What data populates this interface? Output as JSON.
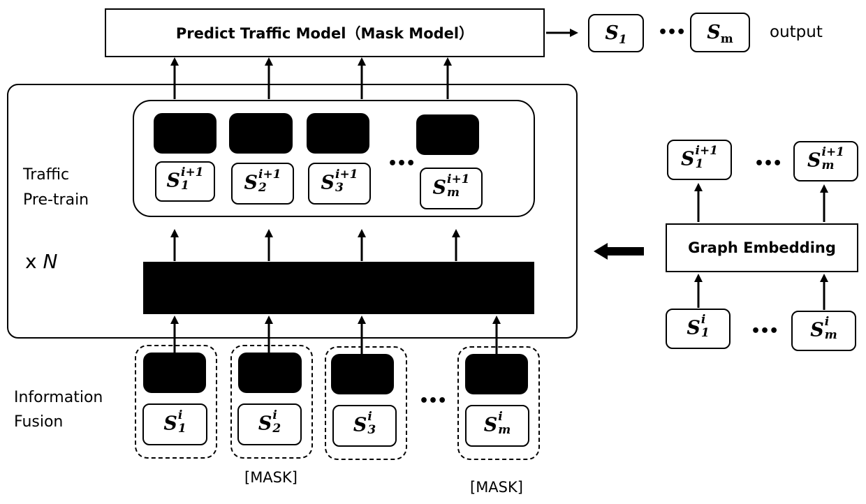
{
  "diagram": {
    "predict_model_label": "Predict Traffic Model（Mask Model）",
    "output_label": "output",
    "outputs": [
      {
        "base": "S",
        "sub": "1"
      },
      {
        "base": "S",
        "sub": "m"
      }
    ],
    "ellipsis": "•••",
    "pretrain": {
      "label_line1": "Traffic",
      "label_line2": "Pre-train",
      "repeat_prefix": "x ",
      "repeat_var": "N",
      "states_next": [
        {
          "base": "S",
          "sub": "1",
          "sup": "i+1"
        },
        {
          "base": "S",
          "sub": "2",
          "sup": "i+1"
        },
        {
          "base": "S",
          "sub": "3",
          "sup": "i+1"
        },
        {
          "base": "S",
          "sub": "m",
          "sup": "i+1"
        }
      ]
    },
    "fusion": {
      "label_line1": "Information",
      "label_line2": "Fusion",
      "states": [
        {
          "base": "S",
          "sub": "1",
          "sup": "i"
        },
        {
          "base": "S",
          "sub": "2",
          "sup": "i"
        },
        {
          "base": "S",
          "sub": "3",
          "sup": "i"
        },
        {
          "base": "S",
          "sub": "m",
          "sup": "i"
        }
      ],
      "mask_labels": [
        "[MASK]",
        "[MASK]"
      ]
    },
    "graph": {
      "label": "Graph Embedding",
      "outputs": [
        {
          "base": "S",
          "sub": "1",
          "sup": "i+1"
        },
        {
          "base": "S",
          "sub": "m",
          "sup": "i+1"
        }
      ],
      "inputs": [
        {
          "base": "S",
          "sub": "1",
          "sup": "i"
        },
        {
          "base": "S",
          "sub": "m",
          "sup": "i"
        }
      ]
    }
  }
}
